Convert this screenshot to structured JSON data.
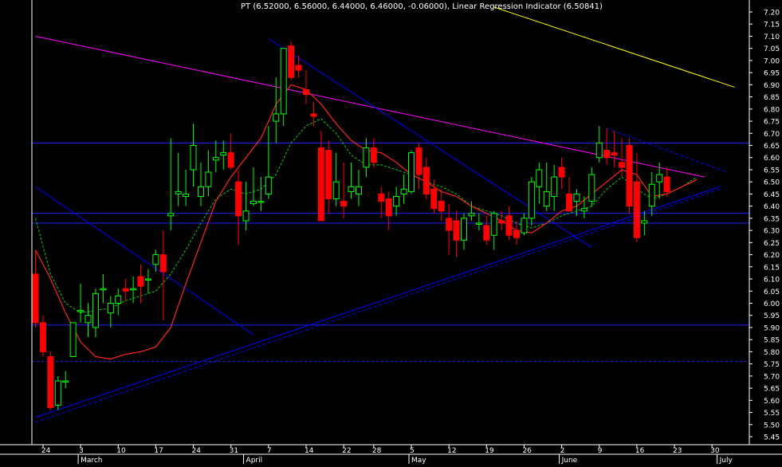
{
  "chart_data": {
    "type": "candlestick",
    "title": "PT (6.52000, 6.56000, 6.44000, 6.46000, -0.06000), Linear Regression Indicator (6.50841)",
    "ylim": [
      5.45,
      7.2
    ],
    "y_ticks": [
      "5.45",
      "5.50",
      "5.55",
      "5.60",
      "5.65",
      "5.70",
      "5.75",
      "5.80",
      "5.85",
      "5.90",
      "5.95",
      "6.00",
      "6.05",
      "6.10",
      "6.15",
      "6.20",
      "6.25",
      "6.30",
      "6.35",
      "6.40",
      "6.45",
      "6.50",
      "6.55",
      "6.60",
      "6.65",
      "6.70",
      "6.75",
      "6.80",
      "6.85",
      "6.90",
      "6.95",
      "7.00",
      "7.05",
      "7.10",
      "7.15",
      "7.20"
    ],
    "x_ticks": [
      {
        "label": "24",
        "i": 1
      },
      {
        "label": "3",
        "i": 6
      },
      {
        "label": "10",
        "i": 11
      },
      {
        "label": "17",
        "i": 16
      },
      {
        "label": "24",
        "i": 21
      },
      {
        "label": "31",
        "i": 26
      },
      {
        "label": "7",
        "i": 31
      },
      {
        "label": "14",
        "i": 36
      },
      {
        "label": "22",
        "i": 41
      },
      {
        "label": "28",
        "i": 45
      },
      {
        "label": "5",
        "i": 50
      },
      {
        "label": "12",
        "i": 55
      },
      {
        "label": "19",
        "i": 60
      },
      {
        "label": "26",
        "i": 65
      },
      {
        "label": "2",
        "i": 70
      },
      {
        "label": "9",
        "i": 75
      },
      {
        "label": "16",
        "i": 80
      },
      {
        "label": "23",
        "i": 85
      },
      {
        "label": "30",
        "i": 90
      }
    ],
    "months": [
      {
        "label": "March",
        "i": 6
      },
      {
        "label": "April",
        "i": 28
      },
      {
        "label": "May",
        "i": 50
      },
      {
        "label": "June",
        "i": 70
      },
      {
        "label": "July",
        "i": 91
      }
    ],
    "colors": {
      "up": "#00ff00",
      "down": "#ff0000",
      "bg": "#000000",
      "grid": "#3a3a80",
      "axis_text": "#ffffff",
      "lr": "#ff2020",
      "ma": "#00cc00",
      "trend": "#2020ff",
      "magenta": "#ff00ff",
      "yellow": "#ffff00"
    },
    "candles": [
      [
        6.12,
        6.22,
        5.9,
        5.92
      ],
      [
        5.92,
        5.95,
        5.78,
        5.8
      ],
      [
        5.78,
        5.8,
        5.56,
        5.57
      ],
      [
        5.58,
        5.7,
        5.56,
        5.68
      ],
      [
        5.68,
        5.72,
        5.65,
        5.68
      ],
      [
        5.78,
        5.92,
        5.78,
        5.92
      ],
      [
        5.97,
        6.08,
        5.92,
        5.97
      ],
      [
        5.92,
        6.0,
        5.86,
        5.95
      ],
      [
        5.9,
        6.06,
        5.86,
        6.04
      ],
      [
        6.06,
        6.12,
        6.0,
        6.06
      ],
      [
        5.96,
        6.03,
        5.9,
        6.0
      ],
      [
        6.0,
        6.06,
        5.95,
        6.03
      ],
      [
        6.06,
        6.1,
        6.01,
        6.05
      ],
      [
        6.06,
        6.11,
        6.0,
        6.06
      ],
      [
        6.11,
        6.16,
        6.0,
        6.07
      ],
      [
        6.1,
        6.14,
        6.04,
        6.1
      ],
      [
        6.16,
        6.22,
        6.13,
        6.2
      ],
      [
        6.2,
        6.3,
        5.93,
        6.13
      ],
      [
        6.36,
        6.68,
        6.3,
        6.37
      ],
      [
        6.45,
        6.62,
        6.4,
        6.46
      ],
      [
        6.44,
        6.55,
        6.4,
        6.45
      ],
      [
        6.55,
        6.74,
        6.48,
        6.65
      ],
      [
        6.44,
        6.58,
        6.4,
        6.48
      ],
      [
        6.48,
        6.63,
        6.44,
        6.54
      ],
      [
        6.59,
        6.67,
        6.54,
        6.6
      ],
      [
        6.61,
        6.67,
        6.55,
        6.62
      ],
      [
        6.62,
        6.7,
        6.55,
        6.56
      ],
      [
        6.5,
        6.55,
        6.24,
        6.36
      ],
      [
        6.34,
        6.5,
        6.3,
        6.38
      ],
      [
        6.41,
        6.56,
        6.4,
        6.42
      ],
      [
        6.42,
        6.52,
        6.38,
        6.42
      ],
      [
        6.45,
        6.73,
        6.43,
        6.52
      ],
      [
        6.75,
        6.93,
        6.66,
        6.78
      ],
      [
        6.78,
        6.98,
        6.73,
        7.05
      ],
      [
        7.06,
        7.08,
        6.92,
        6.93
      ],
      [
        6.98,
        7.02,
        6.93,
        6.96
      ],
      [
        6.88,
        6.96,
        6.82,
        6.86
      ],
      [
        6.78,
        6.83,
        6.73,
        6.77
      ],
      [
        6.64,
        6.71,
        6.38,
        6.34
      ],
      [
        6.63,
        6.67,
        6.37,
        6.43
      ],
      [
        6.43,
        6.62,
        6.4,
        6.5
      ],
      [
        6.42,
        6.58,
        6.35,
        6.4
      ],
      [
        6.46,
        6.58,
        6.43,
        6.48
      ],
      [
        6.45,
        6.55,
        6.4,
        6.48
      ],
      [
        6.56,
        6.68,
        6.52,
        6.64
      ],
      [
        6.64,
        6.68,
        6.56,
        6.58
      ],
      [
        6.45,
        6.48,
        6.35,
        6.42
      ],
      [
        6.43,
        6.46,
        6.3,
        6.36
      ],
      [
        6.4,
        6.48,
        6.36,
        6.44
      ],
      [
        6.45,
        6.53,
        6.41,
        6.47
      ],
      [
        6.46,
        6.63,
        6.45,
        6.62
      ],
      [
        6.64,
        6.66,
        6.47,
        6.53
      ],
      [
        6.56,
        6.6,
        6.43,
        6.45
      ],
      [
        6.47,
        6.51,
        6.37,
        6.39
      ],
      [
        6.42,
        6.47,
        6.34,
        6.38
      ],
      [
        6.35,
        6.41,
        6.2,
        6.3
      ],
      [
        6.34,
        6.38,
        6.19,
        6.26
      ],
      [
        6.26,
        6.37,
        6.22,
        6.35
      ],
      [
        6.36,
        6.42,
        6.34,
        6.37
      ],
      [
        6.33,
        6.37,
        6.3,
        6.33
      ],
      [
        6.32,
        6.36,
        6.24,
        6.26
      ],
      [
        6.28,
        6.38,
        6.22,
        6.37
      ],
      [
        6.34,
        6.38,
        6.3,
        6.33
      ],
      [
        6.36,
        6.4,
        6.26,
        6.28
      ],
      [
        6.3,
        6.34,
        6.24,
        6.27
      ],
      [
        6.29,
        6.37,
        6.28,
        6.35
      ],
      [
        6.35,
        6.52,
        6.32,
        6.5
      ],
      [
        6.48,
        6.58,
        6.41,
        6.55
      ],
      [
        6.4,
        6.58,
        6.38,
        6.46
      ],
      [
        6.44,
        6.57,
        6.38,
        6.52
      ],
      [
        6.56,
        6.6,
        6.47,
        6.52
      ],
      [
        6.45,
        6.52,
        6.38,
        6.38
      ],
      [
        6.42,
        6.47,
        6.36,
        6.45
      ],
      [
        6.38,
        6.44,
        6.35,
        6.39
      ],
      [
        6.42,
        6.56,
        6.4,
        6.53
      ],
      [
        6.6,
        6.73,
        6.58,
        6.66
      ],
      [
        6.63,
        6.72,
        6.57,
        6.6
      ],
      [
        6.62,
        6.71,
        6.56,
        6.61
      ],
      [
        6.58,
        6.68,
        6.52,
        6.56
      ],
      [
        6.65,
        6.68,
        6.37,
        6.4
      ],
      [
        6.5,
        6.62,
        6.25,
        6.27
      ],
      [
        6.33,
        6.38,
        6.28,
        6.34
      ],
      [
        6.4,
        6.54,
        6.36,
        6.49
      ],
      [
        6.5,
        6.58,
        6.43,
        6.53
      ],
      [
        6.52,
        6.56,
        6.44,
        6.46
      ]
    ],
    "lr_indicator": [
      [
        0,
        6.22
      ],
      [
        2,
        6.1
      ],
      [
        4,
        5.96
      ],
      [
        6,
        5.84
      ],
      [
        8,
        5.78
      ],
      [
        10,
        5.77
      ],
      [
        12,
        5.79
      ],
      [
        14,
        5.8
      ],
      [
        16,
        5.82
      ],
      [
        18,
        5.9
      ],
      [
        20,
        6.08
      ],
      [
        22,
        6.25
      ],
      [
        24,
        6.42
      ],
      [
        26,
        6.52
      ],
      [
        28,
        6.6
      ],
      [
        30,
        6.68
      ],
      [
        32,
        6.82
      ],
      [
        33,
        6.86
      ],
      [
        34,
        6.9
      ],
      [
        36,
        6.88
      ],
      [
        38,
        6.82
      ],
      [
        40,
        6.74
      ],
      [
        42,
        6.67
      ],
      [
        44,
        6.63
      ],
      [
        46,
        6.62
      ],
      [
        48,
        6.58
      ],
      [
        50,
        6.53
      ],
      [
        52,
        6.5
      ],
      [
        54,
        6.46
      ],
      [
        56,
        6.44
      ],
      [
        58,
        6.4
      ],
      [
        60,
        6.37
      ],
      [
        62,
        6.34
      ],
      [
        64,
        6.3
      ],
      [
        66,
        6.29
      ],
      [
        68,
        6.33
      ],
      [
        70,
        6.38
      ],
      [
        72,
        6.4
      ],
      [
        74,
        6.45
      ],
      [
        76,
        6.5
      ],
      [
        78,
        6.55
      ],
      [
        80,
        6.53
      ],
      [
        82,
        6.44
      ],
      [
        84,
        6.45
      ],
      [
        86,
        6.48
      ],
      [
        88,
        6.51
      ]
    ],
    "ma_line": [
      [
        0,
        6.35
      ],
      [
        2,
        6.12
      ],
      [
        4,
        6.0
      ],
      [
        6,
        5.96
      ],
      [
        8,
        5.97
      ],
      [
        10,
        5.98
      ],
      [
        12,
        6.01
      ],
      [
        14,
        6.03
      ],
      [
        16,
        6.05
      ],
      [
        18,
        6.12
      ],
      [
        20,
        6.22
      ],
      [
        22,
        6.33
      ],
      [
        24,
        6.43
      ],
      [
        26,
        6.47
      ],
      [
        28,
        6.45
      ],
      [
        30,
        6.47
      ],
      [
        32,
        6.53
      ],
      [
        34,
        6.66
      ],
      [
        36,
        6.73
      ],
      [
        38,
        6.76
      ],
      [
        40,
        6.7
      ],
      [
        42,
        6.61
      ],
      [
        44,
        6.57
      ],
      [
        46,
        6.57
      ],
      [
        48,
        6.55
      ],
      [
        50,
        6.53
      ],
      [
        52,
        6.5
      ],
      [
        54,
        6.48
      ],
      [
        56,
        6.45
      ],
      [
        58,
        6.4
      ],
      [
        60,
        6.38
      ],
      [
        62,
        6.36
      ],
      [
        64,
        6.33
      ],
      [
        66,
        6.31
      ],
      [
        68,
        6.33
      ],
      [
        70,
        6.36
      ],
      [
        72,
        6.38
      ],
      [
        74,
        6.4
      ],
      [
        76,
        6.47
      ],
      [
        78,
        6.52
      ],
      [
        80,
        6.47
      ],
      [
        82,
        6.43
      ],
      [
        84,
        6.45
      ],
      [
        86,
        6.48
      ],
      [
        88,
        6.52
      ]
    ],
    "hlines": [
      6.66,
      6.37,
      6.33,
      5.91
    ],
    "dotted_hline": 5.76,
    "trendlines": [
      {
        "color": "magenta",
        "pts": [
          [
            0,
            7.1
          ],
          [
            89,
            6.52
          ]
        ]
      },
      {
        "color": "yellow",
        "pts": [
          [
            61,
            7.22
          ],
          [
            93,
            6.89
          ]
        ]
      },
      {
        "color": "blue",
        "pts": [
          [
            0,
            5.53
          ],
          [
            91,
            6.48
          ]
        ]
      },
      {
        "color": "blue",
        "pts": [
          [
            31,
            7.09
          ],
          [
            74,
            6.23
          ]
        ]
      },
      {
        "color": "blue",
        "pts": [
          [
            0,
            6.48
          ],
          [
            29,
            5.87
          ]
        ]
      }
    ],
    "dashed_trendlines": [
      {
        "color": "blue",
        "pts": [
          [
            0,
            5.51
          ],
          [
            91,
            6.47
          ]
        ]
      },
      {
        "color": "blue",
        "pts": [
          [
            76,
            6.72
          ],
          [
            92,
            6.54
          ]
        ]
      }
    ]
  }
}
